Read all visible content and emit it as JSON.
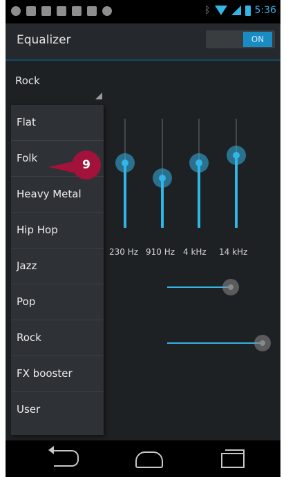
{
  "status_bar": {
    "time": "5:36",
    "left_icons": [
      "headset-icon",
      "mail-icon",
      "chat-icon",
      "sd-card-icon",
      "bag-icon",
      "bag-icon",
      "cloud-icon"
    ],
    "right_icons": [
      "bluetooth-icon",
      "wifi-icon",
      "signal-icon",
      "battery-icon"
    ]
  },
  "action_bar": {
    "title": "Equalizer",
    "toggle_label": "ON"
  },
  "preset": {
    "selected": "Rock"
  },
  "bands": [
    {
      "label": "230 Hz"
    },
    {
      "label": "910 Hz"
    },
    {
      "label": "4 kHz"
    },
    {
      "label": "14 kHz"
    }
  ],
  "dropdown": {
    "items": [
      "Flat",
      "Folk",
      "Heavy Metal",
      "Hip Hop",
      "Jazz",
      "Pop",
      "Rock",
      "FX booster",
      "User"
    ]
  },
  "callout": {
    "label": "9"
  },
  "colors": {
    "accent": "#33b5e5",
    "callout": "#a3123b",
    "background": "#1e2124"
  },
  "navigation": [
    "back-icon",
    "home-icon",
    "recent-apps-icon"
  ]
}
